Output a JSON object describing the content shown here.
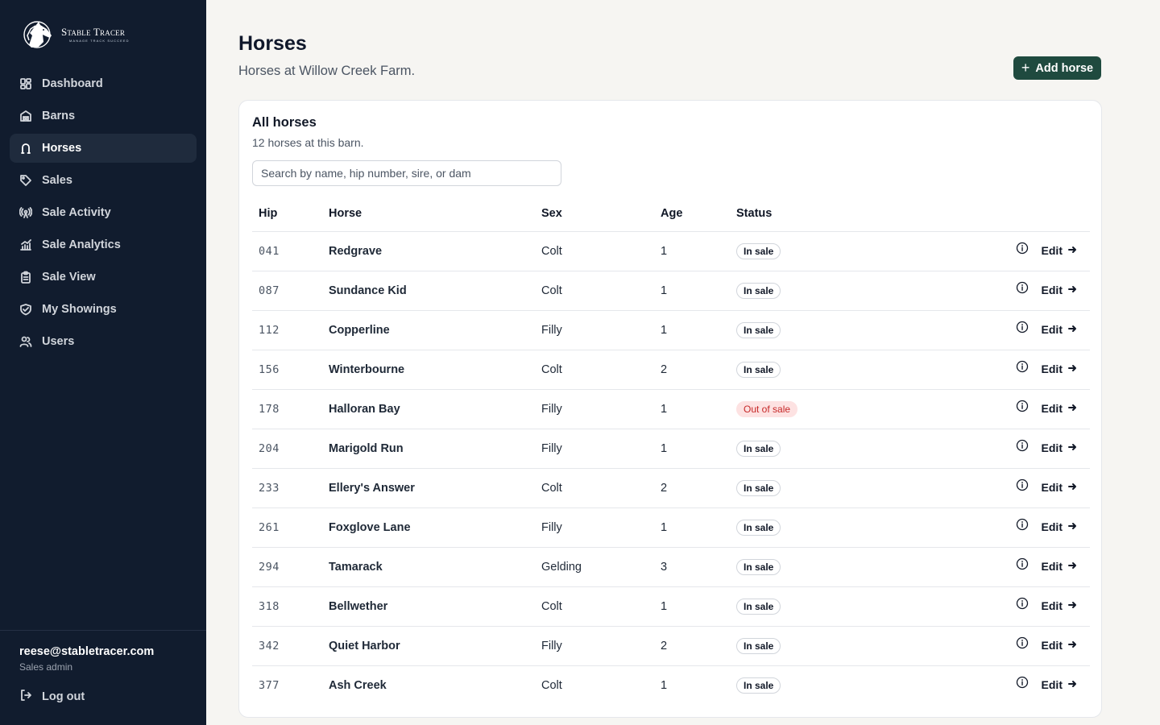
{
  "brand": {
    "name": "Stable Tracer",
    "tagline": "Manage Track Succeed",
    "logo_icon": "horse-head-icon"
  },
  "nav": [
    {
      "label": "Dashboard",
      "icon": "dashboard-icon",
      "active": false
    },
    {
      "label": "Barns",
      "icon": "barn-icon",
      "active": false
    },
    {
      "label": "Horses",
      "icon": "horseshoe-icon",
      "active": true
    },
    {
      "label": "Sales",
      "icon": "tag-icon",
      "active": false
    },
    {
      "label": "Sale Activity",
      "icon": "broadcast-icon",
      "active": false
    },
    {
      "label": "Sale Analytics",
      "icon": "chart-icon",
      "active": false
    },
    {
      "label": "Sale View",
      "icon": "clipboard-icon",
      "active": false
    },
    {
      "label": "My Showings",
      "icon": "handshake-icon",
      "active": false
    },
    {
      "label": "Users",
      "icon": "users-icon",
      "active": false
    }
  ],
  "user": {
    "email": "reese@stabletracer.com",
    "role": "Sales admin",
    "logout_label": "Log out"
  },
  "header": {
    "title": "Horses",
    "subtitle": "Horses at Willow Creek Farm.",
    "add_label": "Add horse"
  },
  "card": {
    "title": "All horses",
    "subtitle": "12 horses at this barn.",
    "search_placeholder": "Search by name, hip number, sire, or dam"
  },
  "table": {
    "columns": [
      "Hip",
      "Horse",
      "Sex",
      "Age",
      "Status"
    ],
    "edit_label": "Edit",
    "rows": [
      {
        "hip": "041",
        "horse": "Redgrave",
        "sex": "Colt",
        "age": "1",
        "status": "In sale"
      },
      {
        "hip": "087",
        "horse": "Sundance Kid",
        "sex": "Colt",
        "age": "1",
        "status": "In sale"
      },
      {
        "hip": "112",
        "horse": "Copperline",
        "sex": "Filly",
        "age": "1",
        "status": "In sale"
      },
      {
        "hip": "156",
        "horse": "Winterbourne",
        "sex": "Colt",
        "age": "2",
        "status": "In sale"
      },
      {
        "hip": "178",
        "horse": "Halloran Bay",
        "sex": "Filly",
        "age": "1",
        "status": "Out of sale"
      },
      {
        "hip": "204",
        "horse": "Marigold Run",
        "sex": "Filly",
        "age": "1",
        "status": "In sale"
      },
      {
        "hip": "233",
        "horse": "Ellery's Answer",
        "sex": "Colt",
        "age": "2",
        "status": "In sale"
      },
      {
        "hip": "261",
        "horse": "Foxglove Lane",
        "sex": "Filly",
        "age": "1",
        "status": "In sale"
      },
      {
        "hip": "294",
        "horse": "Tamarack",
        "sex": "Gelding",
        "age": "3",
        "status": "In sale"
      },
      {
        "hip": "318",
        "horse": "Bellwether",
        "sex": "Colt",
        "age": "1",
        "status": "In sale"
      },
      {
        "hip": "342",
        "horse": "Quiet Harbor",
        "sex": "Filly",
        "age": "2",
        "status": "In sale"
      },
      {
        "hip": "377",
        "horse": "Ash Creek",
        "sex": "Colt",
        "age": "1",
        "status": "In sale"
      }
    ]
  },
  "colors": {
    "sidebar_bg": "#111c2e",
    "accent": "#1f4a3f",
    "page_bg": "#f6f5f2",
    "out_of_sale_bg": "#fde2e2",
    "out_of_sale_text": "#c62828"
  }
}
